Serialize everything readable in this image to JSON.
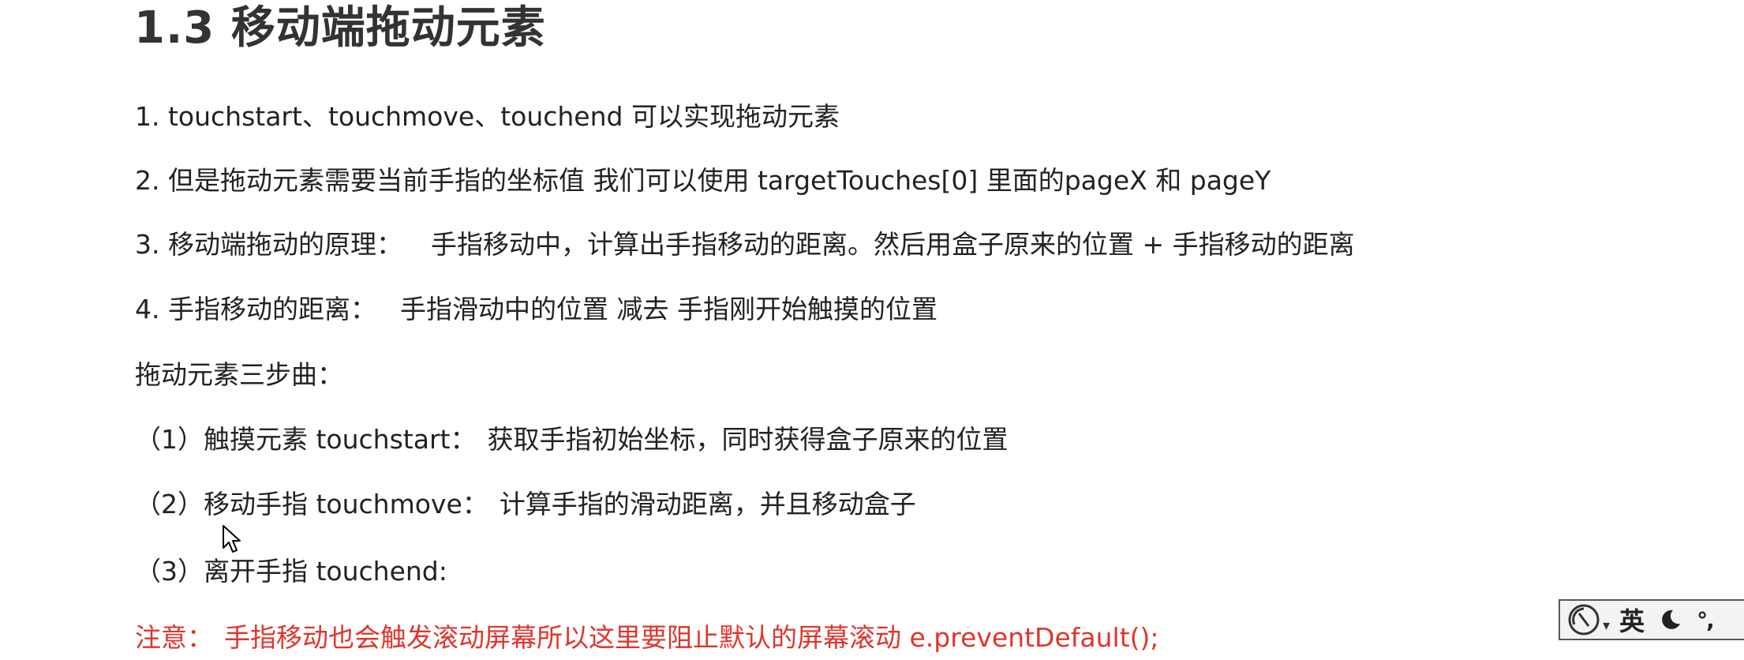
{
  "slide": {
    "title": "1.3 移动端拖动元素",
    "lines": [
      {
        "pre": "1. touchstart、touchmove、touchend 可以实现拖动元素",
        "post": ""
      },
      {
        "pre": "2. 但是拖动元素需要当前手指的坐标值 我们可以使用  targetTouches[0] 里面的pageX 和 pageY",
        "post": ""
      },
      {
        "pre": "3. 移动端拖动的原理：",
        "post": "手指移动中，计算出手指移动的距离。然后用盒子原来的位置 + 手指移动的距离"
      },
      {
        "pre": "4. 手指移动的距离：",
        "post": "手指滑动中的位置 减去  手指刚开始触摸的位置"
      },
      {
        "pre": "拖动元素三步曲：",
        "post": ""
      },
      {
        "pre": "（1）触摸元素 touchstart：",
        "post": "获取手指初始坐标，同时获得盒子原来的位置"
      },
      {
        "pre": "（2）移动手指 touchmove：",
        "post": "计算手指的滑动距离，并且移动盒子"
      },
      {
        "pre": "（3）离开手指 touchend:",
        "post": ""
      }
    ],
    "note": {
      "label": "注意：",
      "text": "手指移动也会触发滚动屏幕所以这里要阻止默认的屏幕滚动 e.preventDefault();"
    },
    "note_color": "#e0352b"
  },
  "ime_toolbar": {
    "logo_icon": "ime-logo-icon",
    "language": "英",
    "moon_icon": "half-moon-icon",
    "punctuation": "°,"
  }
}
